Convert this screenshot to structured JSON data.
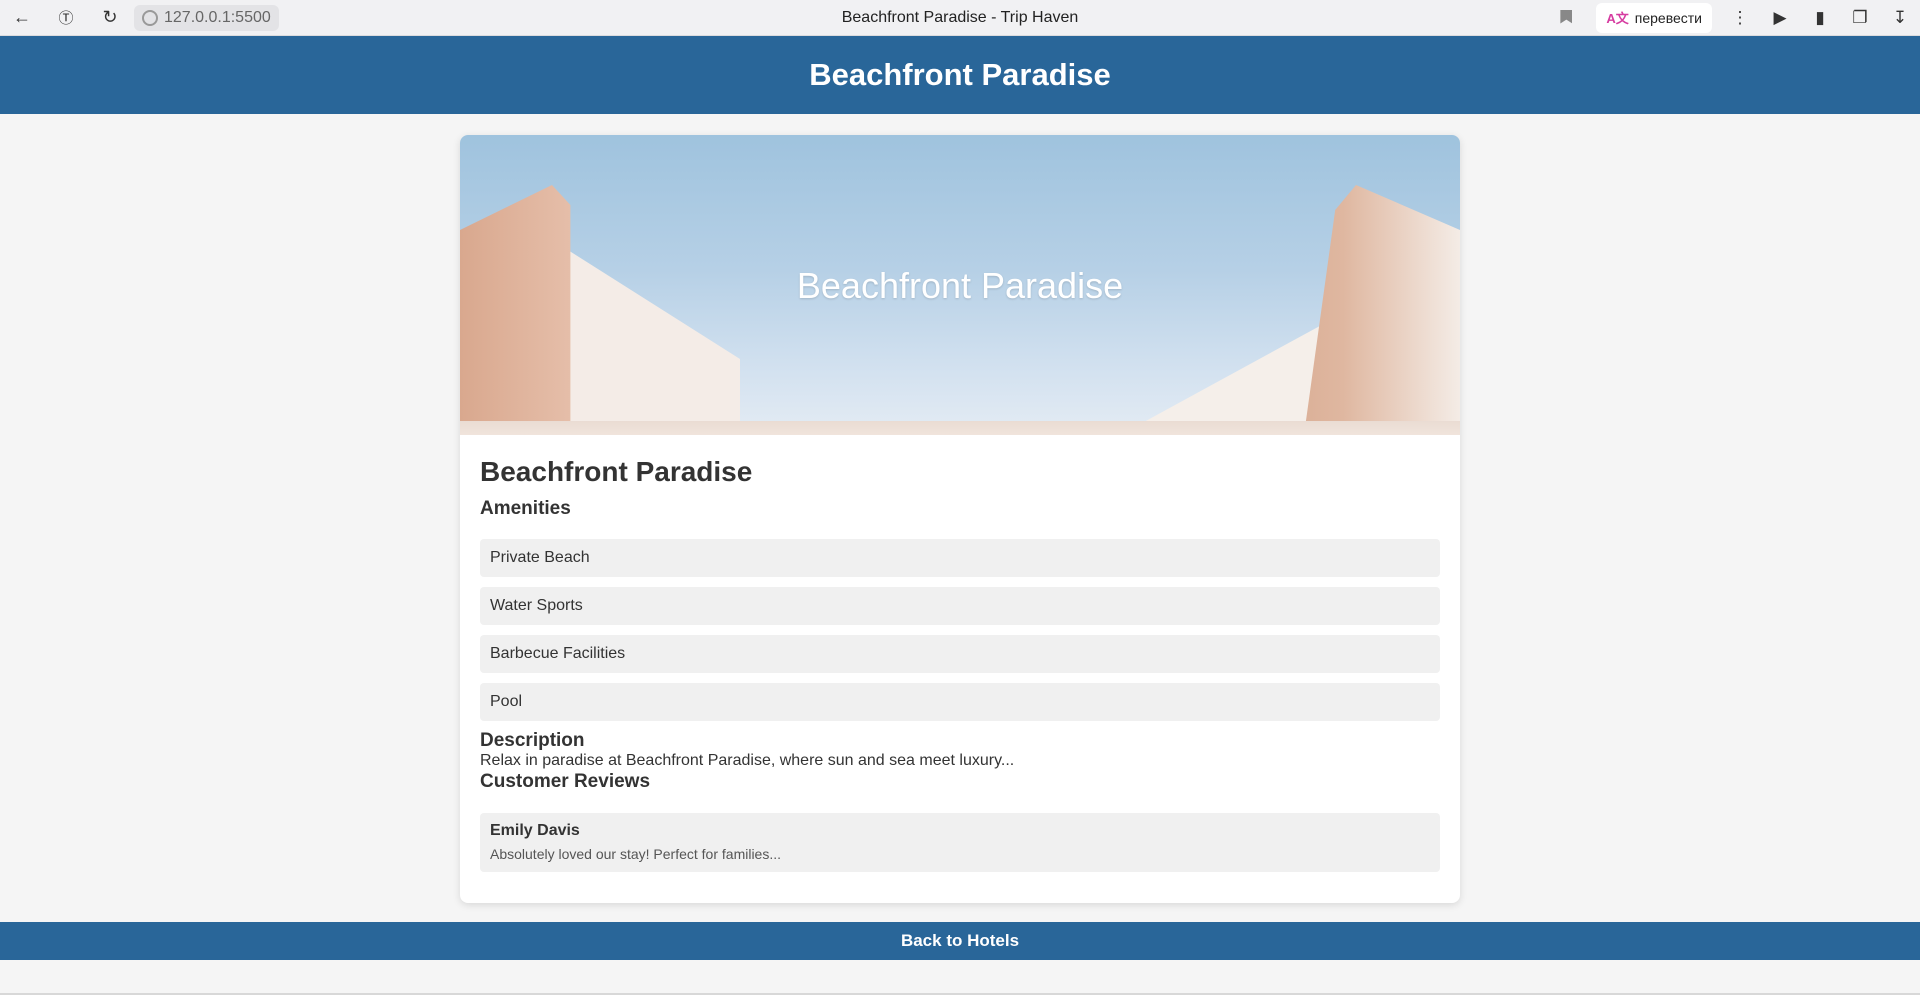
{
  "browser": {
    "url": "127.0.0.1:5500",
    "tab_title": "Beachfront Paradise - Trip Haven",
    "translate_label": "перевести",
    "icons": [
      "back-icon",
      "yandex-icon",
      "reload-icon",
      "site-info-icon",
      "bookmark-icon",
      "translate-icon",
      "menu-icon",
      "media-icon",
      "battery-icon",
      "collections-icon",
      "download-icon"
    ]
  },
  "header": {
    "title": "Beachfront Paradise"
  },
  "hero": {
    "overlay_title": "Beachfront Paradise"
  },
  "hotel": {
    "name": "Beachfront Paradise",
    "amenities_title": "Amenities",
    "amenities": [
      "Private Beach",
      "Water Sports",
      "Barbecue Facilities",
      "Pool"
    ],
    "description_title": "Description",
    "description": "Relax in paradise at Beachfront Paradise, where sun and sea meet luxury...",
    "reviews_title": "Customer Reviews",
    "reviews": [
      {
        "author": "Emily Davis",
        "text": "Absolutely loved our stay! Perfect for families..."
      }
    ]
  },
  "footer": {
    "back_label": "Back to Hotels"
  },
  "colors": {
    "brand": "#296699",
    "page_bg": "#f5f5f5",
    "item_bg": "#f0f0f0"
  }
}
